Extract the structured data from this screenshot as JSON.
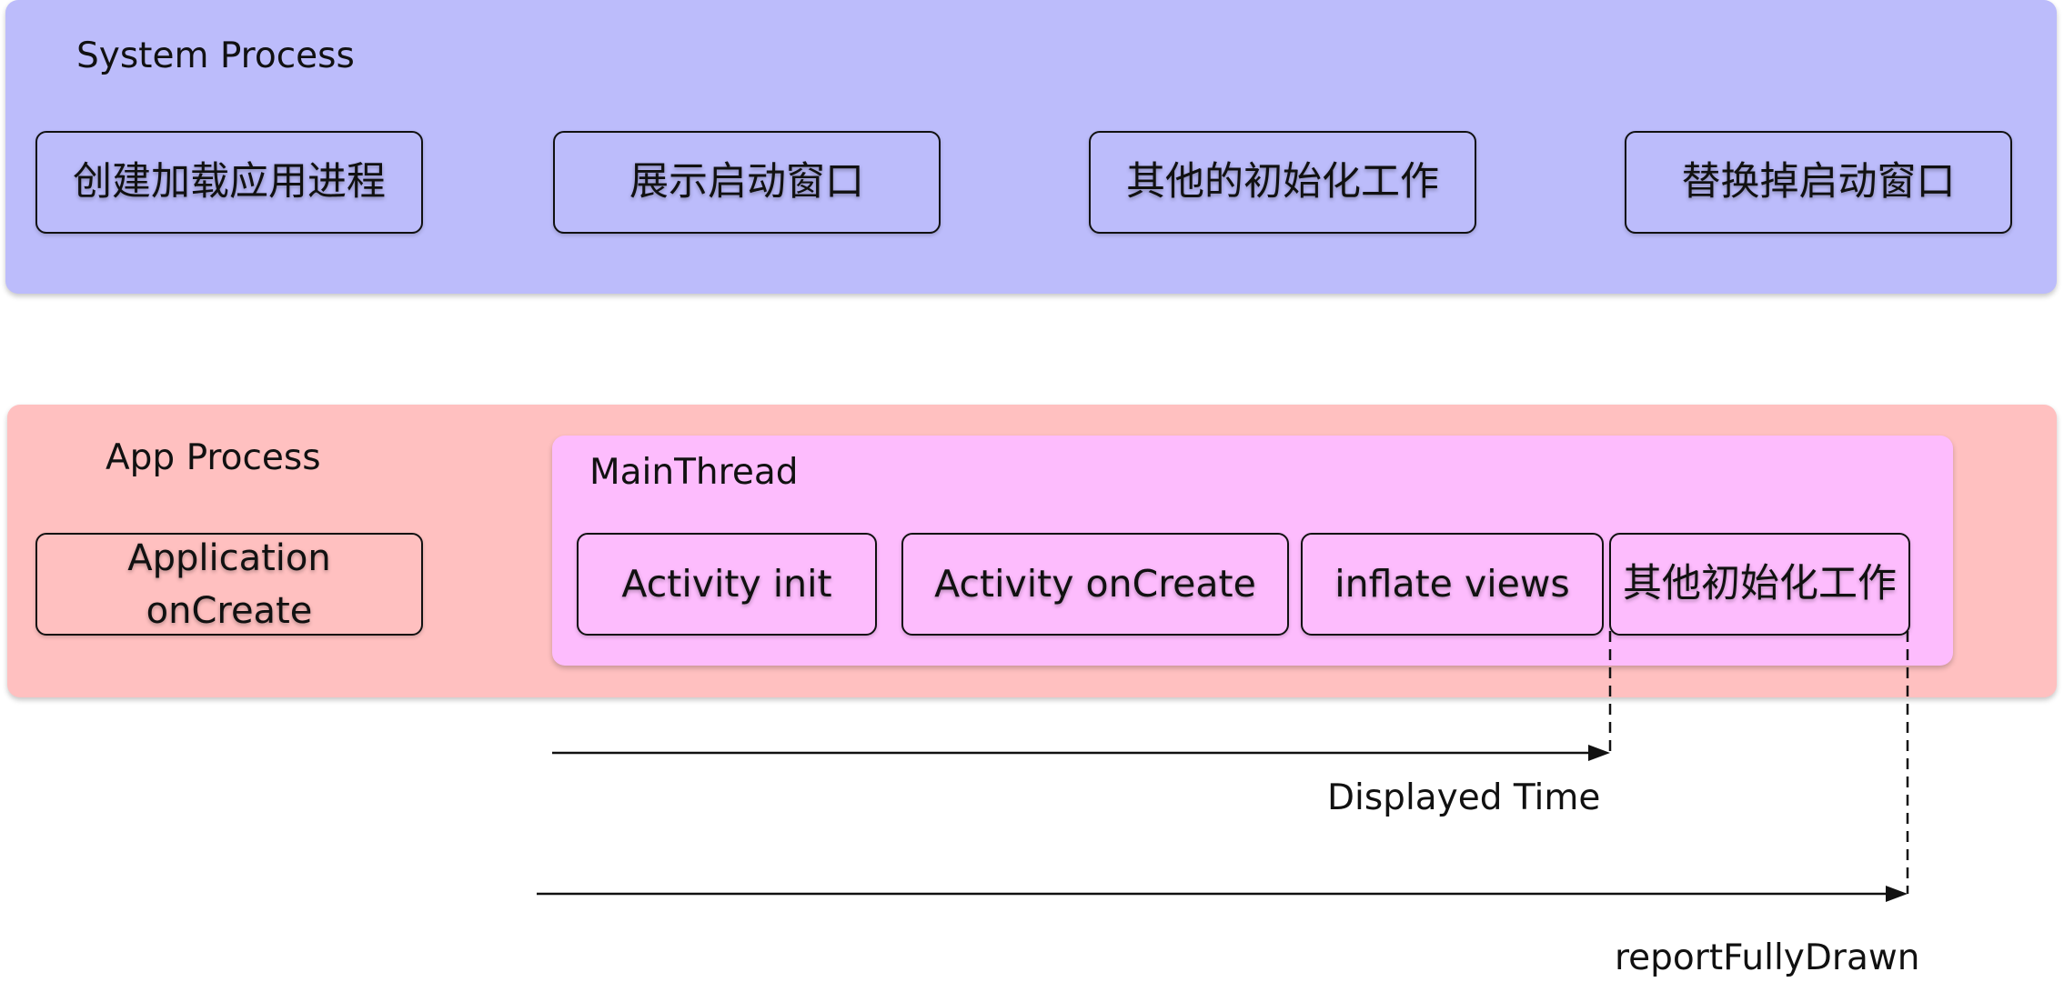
{
  "system_process": {
    "title": "System Process",
    "steps": [
      "创建加载应用进程",
      "展示启动窗口",
      "其他的初始化工作",
      "替换掉启动窗口"
    ]
  },
  "app_process": {
    "title": "App Process",
    "application_step": "Application onCreate",
    "main_thread": {
      "title": "MainThread",
      "steps": [
        "Activity init",
        "Activity onCreate",
        "inflate views",
        "其他初始化工作"
      ]
    }
  },
  "measurements": {
    "displayed_time": "Displayed Time",
    "report_fully_drawn": "reportFullyDrawn"
  },
  "colors": {
    "system_process_bg": "#bcbcfb",
    "app_process_bg": "#ffc0c0",
    "main_thread_bg": "#fdbcfd",
    "stroke": "#111111"
  }
}
